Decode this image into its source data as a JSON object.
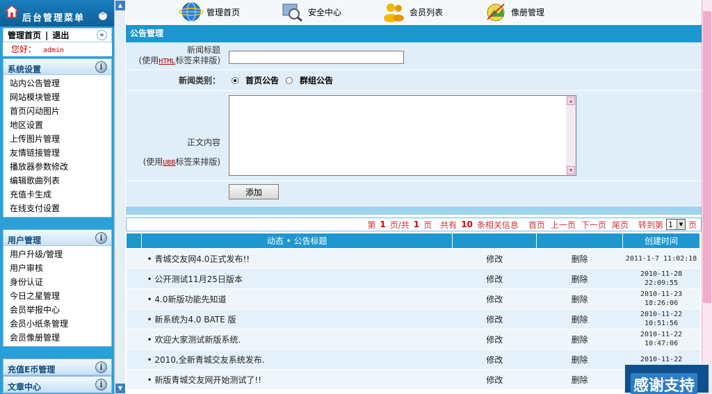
{
  "sidebar": {
    "title": "后台管理菜单",
    "nav_home": "管理首页",
    "nav_sep": "|",
    "nav_logout": "退出",
    "greeting": "您好：",
    "username": "admin",
    "sections": [
      {
        "label": "系统设置",
        "items": [
          "站内公告管理",
          "网站模块管理",
          "首页闪动图片",
          "地区设置",
          "上传图片管理",
          "友情链接管理",
          "播放器参数修改",
          "编辑歌曲列表",
          "充值卡生成",
          "在线支付设置"
        ]
      },
      {
        "label": "用户管理",
        "items": [
          "用户升级/管理",
          "用户审核",
          "身份认证",
          "今日之星管理",
          "会员举报中心",
          "会员小纸条管理",
          "会员像册管理"
        ]
      },
      {
        "label": "充值E币管理",
        "items": []
      },
      {
        "label": "文章中心",
        "items": []
      }
    ]
  },
  "topbar": {
    "items": [
      {
        "label": "管理首页",
        "icon": "globe-icon"
      },
      {
        "label": "安全中心",
        "icon": "shield-search-icon"
      },
      {
        "label": "会员列表",
        "icon": "users-icon"
      },
      {
        "label": "像册管理",
        "icon": "photo-album-icon"
      }
    ]
  },
  "panel": {
    "title": "公告管理",
    "news_title_label": "新闻标题",
    "news_title_hint_pre": "(使用",
    "news_title_hint_tag": "HTML",
    "news_title_hint_post": "标签来排版)",
    "news_title_value": "",
    "category_label": "新闻类别：",
    "category_options": [
      "首页公告",
      "群组公告"
    ],
    "category_selected": "首页公告",
    "body_label": "正文内容",
    "body_hint_pre": "(使用",
    "body_hint_tag": "UBB",
    "body_hint_post": "标签来排版)",
    "body_value": "",
    "submit_label": "添加"
  },
  "pager": {
    "text_di": "第",
    "current_page": "1",
    "text_page_total": "页/共",
    "total_pages": "1",
    "text_page": "页",
    "text_total": "共有",
    "total_items": "10",
    "text_items": "条相关信息",
    "first": "首页",
    "prev": "上一页",
    "next": "下一页",
    "last": "尾页",
    "goto": "转到第",
    "goto_value": "1",
    "goto_suffix": "页"
  },
  "table": {
    "headers": [
      "动态 • 公告标题",
      "",
      "",
      "创建时间"
    ],
    "edit_label": "修改",
    "delete_label": "删除",
    "rows": [
      {
        "title": "• 青城交友网4.0正式发布!!",
        "date1": "2011-1-7 11:02:18",
        "date2": ""
      },
      {
        "title": "• 公开测试11月25日版本",
        "date1": "2010-11-28",
        "date2": "22:09:55"
      },
      {
        "title": "• 4.0新版功能先知道",
        "date1": "2010-11-23",
        "date2": "18:26:06"
      },
      {
        "title": "• 新系统为4.0 BATE 版",
        "date1": "2010-11-22",
        "date2": "10:51:56"
      },
      {
        "title": "• 欢迎大家测试新版系统.",
        "date1": "2010-11-22",
        "date2": "10:47:06"
      },
      {
        "title": "• 2010,全新青城交友系统发布.",
        "date1": "2010-11-22",
        "date2": ""
      },
      {
        "title": "• 新版青城交友网开始测试了!!",
        "date1": "",
        "date2": ""
      }
    ]
  },
  "badge": {
    "text": "感谢支持"
  }
}
